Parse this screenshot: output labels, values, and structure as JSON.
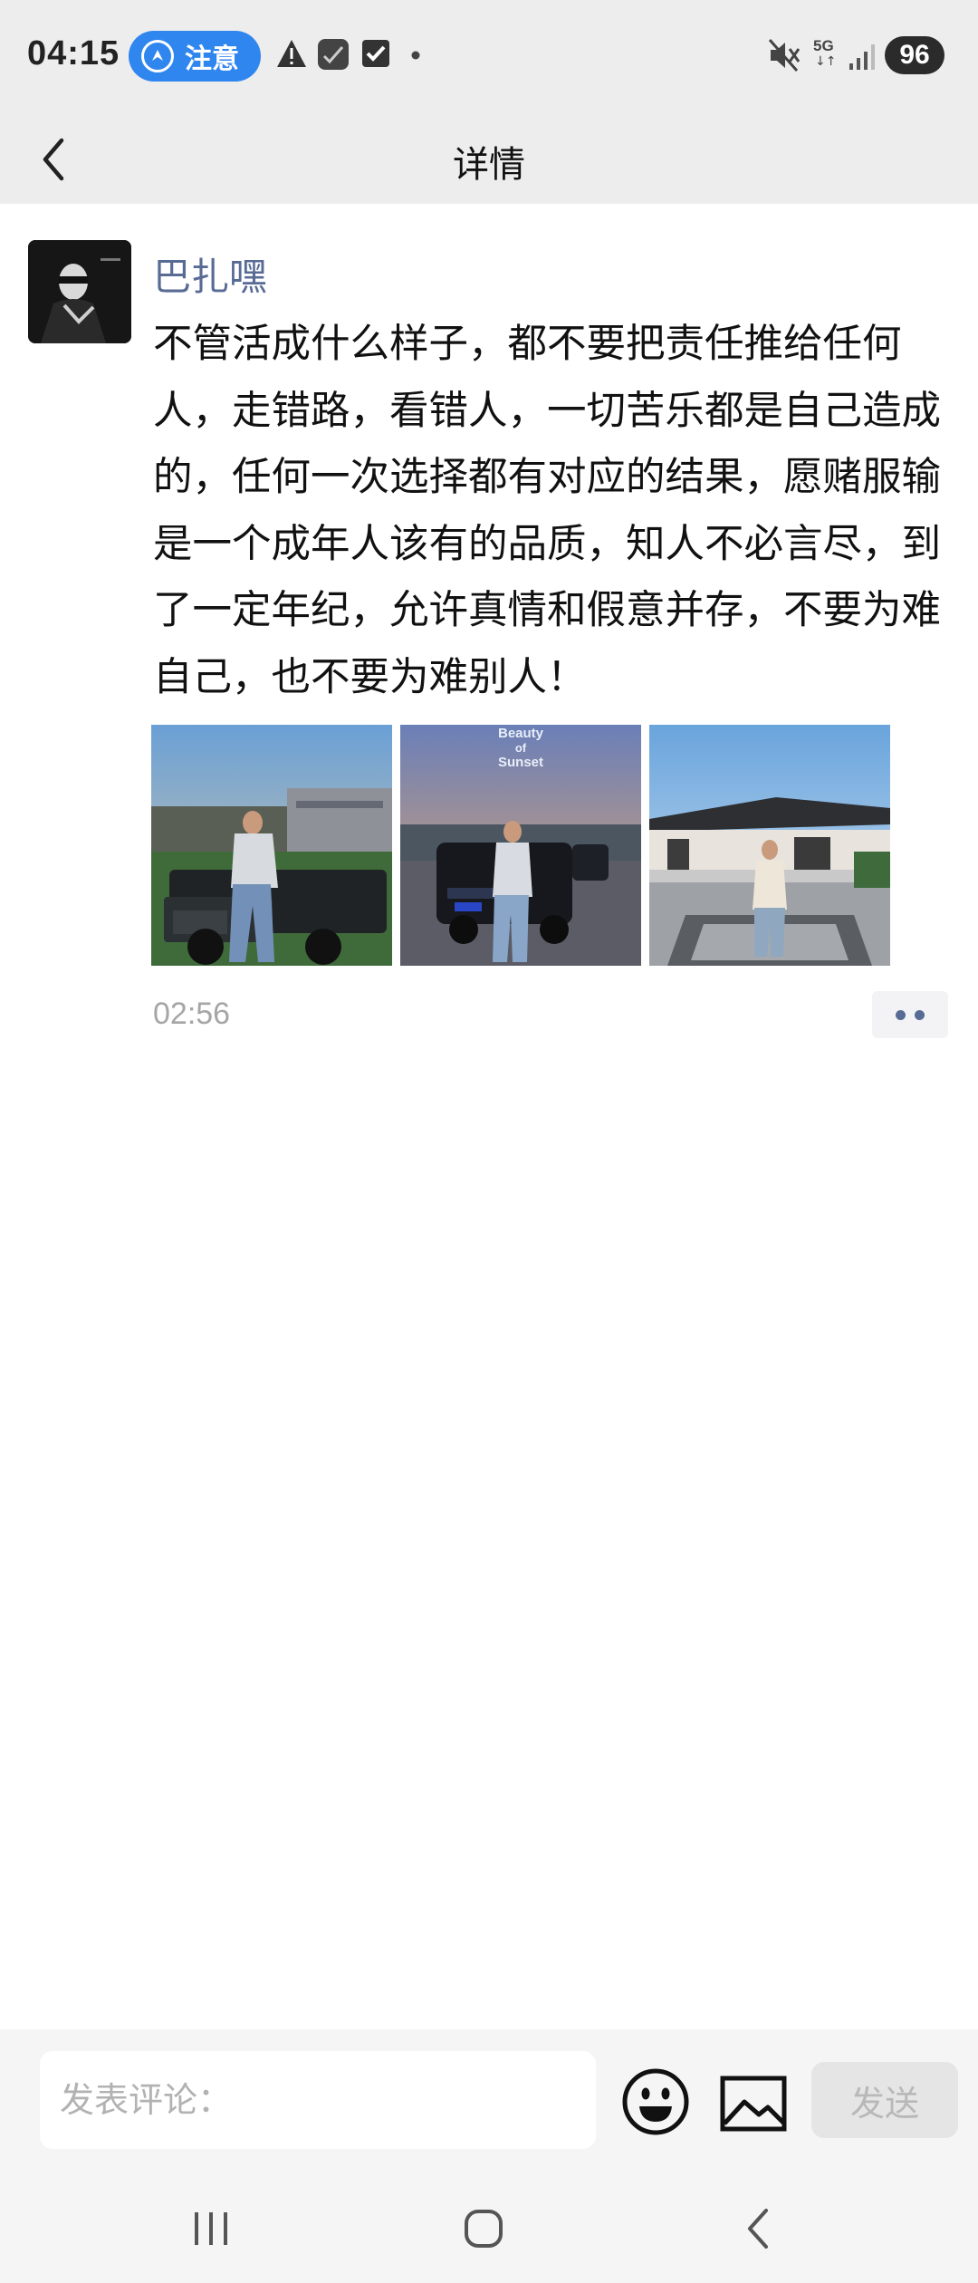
{
  "status_bar": {
    "time": "04:15",
    "notice_label": "注意",
    "network": "5G",
    "battery": "96",
    "icons": [
      "warning-icon",
      "app-notification-icon",
      "checkbox-icon",
      "more-dot-icon",
      "mute-icon",
      "network-5g-icon",
      "signal-icon"
    ]
  },
  "header": {
    "title": "详情",
    "back_icon": "back-arrow-icon"
  },
  "post": {
    "author": "巴扎嘿",
    "text": "不管活成什么样子，都不要把责任推给任何人，走错路，看错人，一切苦乐都是自己造成的，任何一次选择都有对应的结果，愿赌服输是一个成年人该有的品质，知人不必言尽，到了一定年纪，允许真情和假意并存，不要为难自己，也不要为难别人！",
    "photos": [
      {
        "sky_top": "#6aa0d6",
        "sky_bottom": "#d9c8a8"
      },
      {
        "overlay_text_1": "Beauty",
        "overlay_text_2": "of",
        "overlay_text_3": "Sunset",
        "sky_top": "#6a7fb8",
        "sky_bottom": "#e7a86a"
      },
      {
        "sky_top": "#69a4dc",
        "sky_bottom": "#cfe2f2"
      }
    ],
    "time": "02:56",
    "more_icon": "more-dots-icon"
  },
  "comment_bar": {
    "placeholder": "发表评论：",
    "emoji_icon": "emoji-icon",
    "image_icon": "image-icon",
    "send_label": "发送"
  },
  "nav_bar": {
    "icons": [
      "recent-apps-icon",
      "home-icon",
      "back-icon"
    ]
  }
}
